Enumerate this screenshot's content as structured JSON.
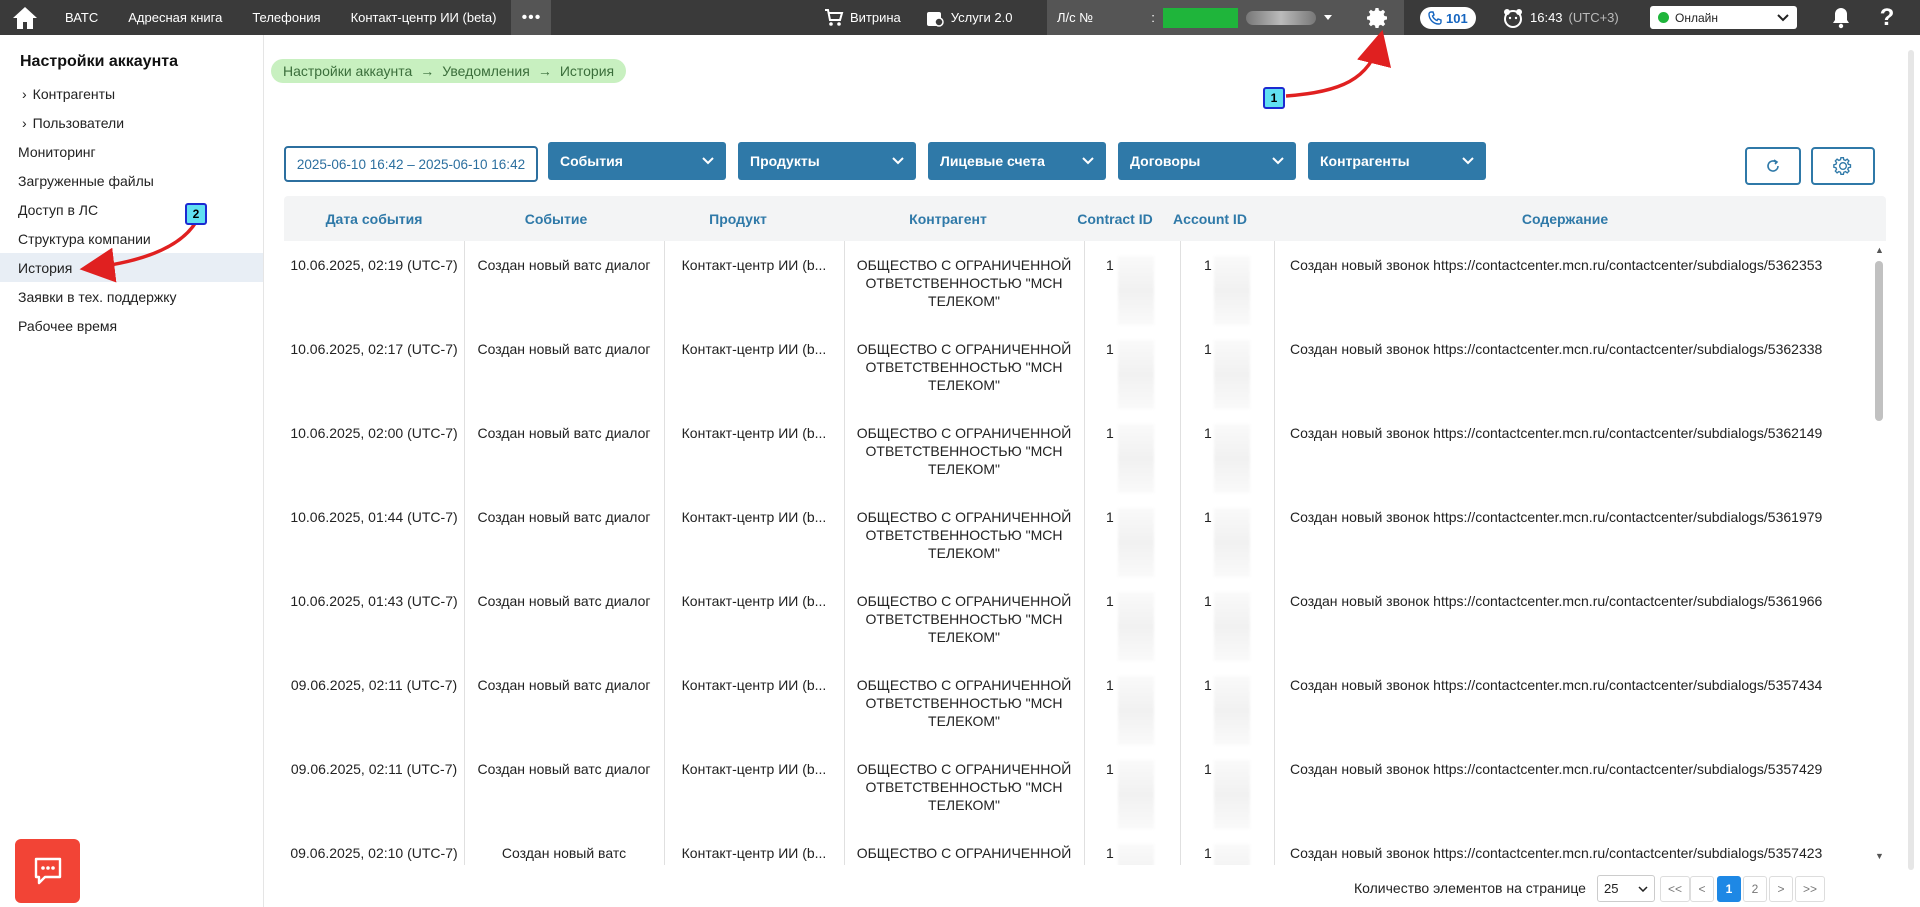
{
  "topbar": {
    "nav": [
      "ВАТС",
      "Адресная книга",
      "Телефония",
      "Контакт-центр ИИ (beta)"
    ],
    "more": "•••",
    "vitrina": "Витрина",
    "services": "Услуги 2.0",
    "account_label": "Л/с №",
    "account_sep": ":",
    "phone_count": "101",
    "time": "16:43",
    "timezone": "(UTC+3)",
    "status": "Онлайн",
    "help": "?"
  },
  "sidebar": {
    "title": "Настройки аккаунта",
    "items": [
      {
        "label": "Контрагенты",
        "sub": true
      },
      {
        "label": "Пользователи",
        "sub": true
      },
      {
        "label": "Мониторинг"
      },
      {
        "label": "Загруженные файлы"
      },
      {
        "label": "Доступ в ЛС"
      },
      {
        "label": "Структура компании"
      },
      {
        "label": "История",
        "active": true
      },
      {
        "label": "Заявки в тех. поддержку"
      },
      {
        "label": "Рабочее время"
      }
    ]
  },
  "breadcrumb": [
    "Настройки аккаунта",
    "Уведомления",
    "История"
  ],
  "filters": {
    "date_range": "2025-06-10 16:42 – 2025-06-10 16:42",
    "dropdowns": [
      "События",
      "Продукты",
      "Лицевые счета",
      "Договоры",
      "Контрагенты"
    ]
  },
  "table": {
    "columns": [
      "Дата события",
      "Событие",
      "Продукт",
      "Контрагент",
      "Contract ID",
      "Account ID",
      "Содержание"
    ],
    "rows": [
      {
        "date": "10.06.2025, 02:19 (UTC-7)",
        "event": "Создан новый ватс диалог",
        "product": "Контакт-центр ИИ (b...",
        "party": "ОБЩЕСТВО С ОГРАНИЧЕННОЙ ОТВЕТСТВЕННОСТЬЮ \"МСН ТЕЛЕКОМ\"",
        "contract": "1",
        "account": "1",
        "content": "Создан новый звонок https://contactcenter.mcn.ru/contactcenter/subdialogs/5362353"
      },
      {
        "date": "10.06.2025, 02:17 (UTC-7)",
        "event": "Создан новый ватс диалог",
        "product": "Контакт-центр ИИ (b...",
        "party": "ОБЩЕСТВО С ОГРАНИЧЕННОЙ ОТВЕТСТВЕННОСТЬЮ \"МСН ТЕЛЕКОМ\"",
        "contract": "1",
        "account": "1",
        "content": "Создан новый звонок https://contactcenter.mcn.ru/contactcenter/subdialogs/5362338"
      },
      {
        "date": "10.06.2025, 02:00 (UTC-7)",
        "event": "Создан новый ватс диалог",
        "product": "Контакт-центр ИИ (b...",
        "party": "ОБЩЕСТВО С ОГРАНИЧЕННОЙ ОТВЕТСТВЕННОСТЬЮ \"МСН ТЕЛЕКОМ\"",
        "contract": "1",
        "account": "1",
        "content": "Создан новый звонок https://contactcenter.mcn.ru/contactcenter/subdialogs/5362149"
      },
      {
        "date": "10.06.2025, 01:44 (UTC-7)",
        "event": "Создан новый ватс диалог",
        "product": "Контакт-центр ИИ (b...",
        "party": "ОБЩЕСТВО С ОГРАНИЧЕННОЙ ОТВЕТСТВЕННОСТЬЮ \"МСН ТЕЛЕКОМ\"",
        "contract": "1",
        "account": "1",
        "content": "Создан новый звонок https://contactcenter.mcn.ru/contactcenter/subdialogs/5361979"
      },
      {
        "date": "10.06.2025, 01:43 (UTC-7)",
        "event": "Создан новый ватс диалог",
        "product": "Контакт-центр ИИ (b...",
        "party": "ОБЩЕСТВО С ОГРАНИЧЕННОЙ ОТВЕТСТВЕННОСТЬЮ \"МСН ТЕЛЕКОМ\"",
        "contract": "1",
        "account": "1",
        "content": "Создан новый звонок https://contactcenter.mcn.ru/contactcenter/subdialogs/5361966"
      },
      {
        "date": "09.06.2025, 02:11 (UTC-7)",
        "event": "Создан новый ватс диалог",
        "product": "Контакт-центр ИИ (b...",
        "party": "ОБЩЕСТВО С ОГРАНИЧЕННОЙ ОТВЕТСТВЕННОСТЬЮ \"МСН ТЕЛЕКОМ\"",
        "contract": "1",
        "account": "1",
        "content": "Создан новый звонок https://contactcenter.mcn.ru/contactcenter/subdialogs/5357434"
      },
      {
        "date": "09.06.2025, 02:11 (UTC-7)",
        "event": "Создан новый ватс диалог",
        "product": "Контакт-центр ИИ (b...",
        "party": "ОБЩЕСТВО С ОГРАНИЧЕННОЙ ОТВЕТСТВЕННОСТЬЮ \"МСН ТЕЛЕКОМ\"",
        "contract": "1",
        "account": "1",
        "content": "Создан новый звонок https://contactcenter.mcn.ru/contactcenter/subdialogs/5357429"
      },
      {
        "date": "09.06.2025, 02:10 (UTC-7)",
        "event": "Создан новый ватс",
        "product": "Контакт-центр ИИ (b...",
        "party": "ОБЩЕСТВО С ОГРАНИЧЕННОЙ",
        "contract": "1",
        "account": "1",
        "content": "Создан новый звонок https://contactcenter.mcn.ru/contactcenter/subdialogs/5357423"
      }
    ]
  },
  "pagination": {
    "label": "Количество элементов на странице",
    "page_size": "25",
    "first": "<<",
    "prev": "<",
    "pages": [
      "1",
      "2"
    ],
    "next": ">",
    "last": ">>"
  },
  "annotations": [
    "1",
    "2"
  ]
}
